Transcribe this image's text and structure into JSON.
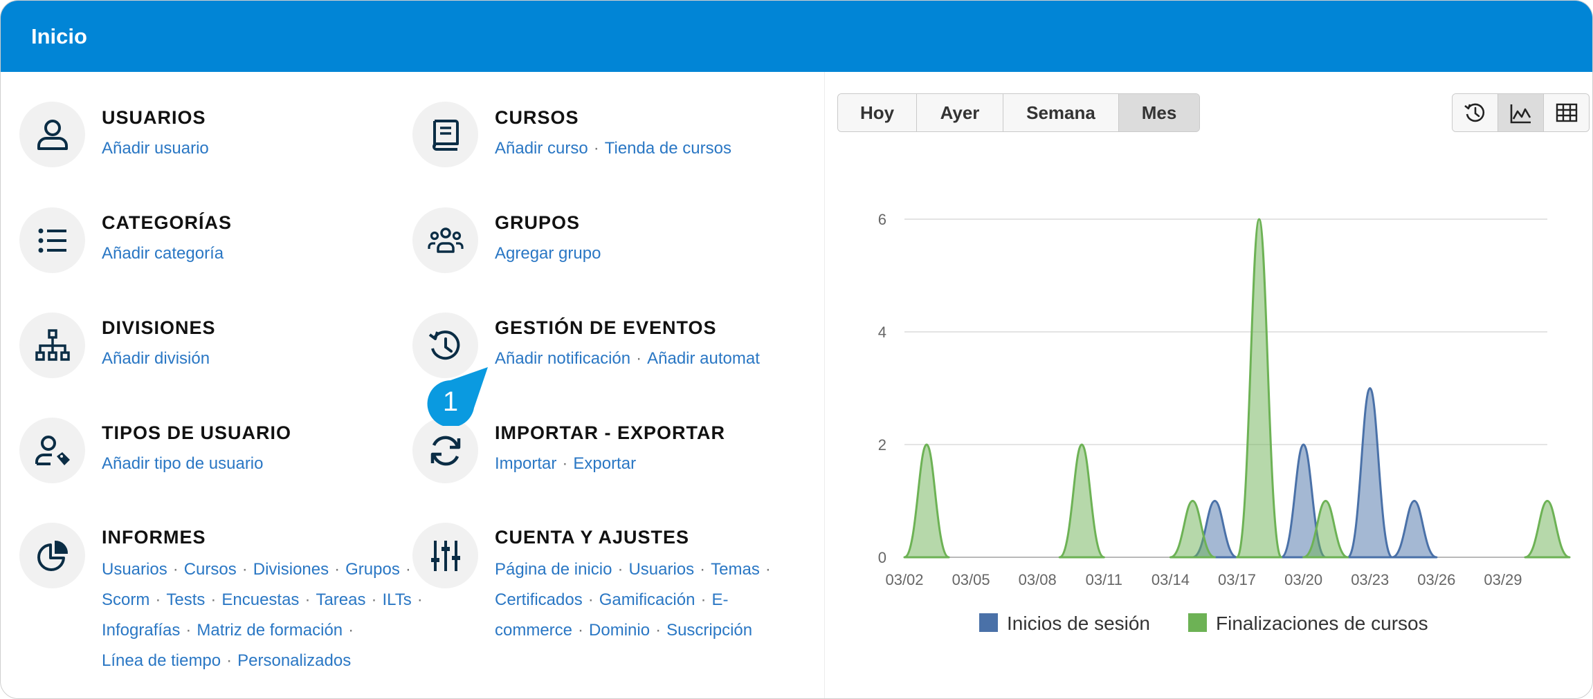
{
  "header": {
    "title": "Inicio"
  },
  "tiles": {
    "usuarios": {
      "icon": "user-icon",
      "title": "USUARIOS",
      "links": [
        "Añadir usuario"
      ]
    },
    "cursos": {
      "icon": "book-icon",
      "title": "CURSOS",
      "links": [
        "Añadir curso",
        "Tienda de cursos"
      ]
    },
    "categorias": {
      "icon": "list-icon",
      "title": "CATEGORÍAS",
      "links": [
        "Añadir categoría"
      ]
    },
    "grupos": {
      "icon": "users-group-icon",
      "title": "GRUPOS",
      "links": [
        "Agregar grupo"
      ]
    },
    "divisiones": {
      "icon": "org-chart-icon",
      "title": "DIVISIONES",
      "links": [
        "Añadir división"
      ]
    },
    "eventos": {
      "icon": "history-icon",
      "title": "GESTIÓN DE EVENTOS",
      "links": [
        "Añadir notificación",
        "Añadir automat"
      ]
    },
    "tipos": {
      "icon": "user-tag-icon",
      "title": "TIPOS DE USUARIO",
      "links": [
        "Añadir tipo de usuario"
      ]
    },
    "importar": {
      "icon": "sync-icon",
      "title": "IMPORTAR - EXPORTAR",
      "links": [
        "Importar",
        "Exportar"
      ]
    },
    "informes": {
      "icon": "pie-chart-icon",
      "title": "INFORMES",
      "links": [
        "Usuarios",
        "Cursos",
        "Divisiones",
        "Grupos",
        "Scorm",
        "Tests",
        "Encuestas",
        "Tareas",
        "ILTs",
        "Infografías",
        "Matriz de formación",
        "Línea de tiempo",
        "Personalizados"
      ]
    },
    "cuenta": {
      "icon": "sliders-icon",
      "title": "CUENTA Y AJUSTES",
      "links": [
        "Página de inicio",
        "Usuarios",
        "Temas",
        "Certificados",
        "Gamificación",
        "E-commerce",
        "Dominio",
        "Suscripción"
      ]
    }
  },
  "marker": {
    "label": "1"
  },
  "toolbar": {
    "periods": [
      "Hoy",
      "Ayer",
      "Semana",
      "Mes"
    ],
    "active_period": "Mes",
    "views": [
      "history-icon",
      "area-chart-icon",
      "table-grid-icon"
    ],
    "active_view": "area-chart-icon"
  },
  "chart_data": {
    "type": "area",
    "x_tick_labels": [
      "03/02",
      "03/05",
      "03/08",
      "03/11",
      "03/14",
      "03/17",
      "03/20",
      "03/23",
      "03/26",
      "03/29"
    ],
    "y_ticks": [
      0,
      2,
      4,
      6
    ],
    "ylim": [
      0,
      6
    ],
    "grid": true,
    "legend_position": "bottom",
    "series": [
      {
        "name": "Inicios de sesión",
        "color": "#4a71a8",
        "points": [
          [
            "03/16",
            1
          ],
          [
            "03/20",
            2
          ],
          [
            "03/23",
            3
          ],
          [
            "03/25",
            1
          ]
        ]
      },
      {
        "name": "Finalizaciones de cursos",
        "color": "#6db255",
        "points": [
          [
            "03/03",
            2
          ],
          [
            "03/10",
            2
          ],
          [
            "03/15",
            1
          ],
          [
            "03/18",
            6
          ],
          [
            "03/21",
            1
          ],
          [
            "03/31",
            1
          ]
        ]
      }
    ]
  }
}
